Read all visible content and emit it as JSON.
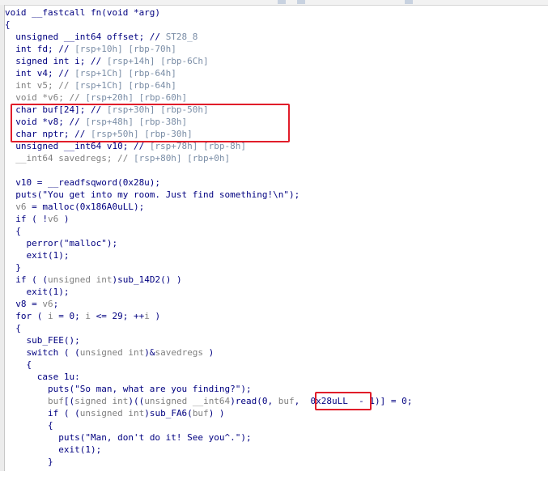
{
  "colors": {
    "normal": "#000080",
    "comment": "#7a8da6",
    "grey": "#808080",
    "highlight": "#e11d2a"
  },
  "code_lines": [
    [
      [
        "n",
        "void __fastcall fn(void *arg)"
      ]
    ],
    [
      [
        "n",
        "{"
      ]
    ],
    [
      [
        "n",
        "  unsigned __int64 offset; // "
      ],
      [
        "c",
        "ST28_8"
      ]
    ],
    [
      [
        "n",
        "  int fd; // "
      ],
      [
        "c",
        "[rsp+10h] [rbp-70h]"
      ]
    ],
    [
      [
        "n",
        "  signed int i; // "
      ],
      [
        "c",
        "[rsp+14h] [rbp-6Ch]"
      ]
    ],
    [
      [
        "n",
        "  int v4; // "
      ],
      [
        "c",
        "[rsp+1Ch] [rbp-64h]"
      ]
    ],
    [
      [
        "g",
        "  int v5; // "
      ],
      [
        "c",
        "[rsp+1Ch] [rbp-64h]"
      ]
    ],
    [
      [
        "g",
        "  void *v6; // "
      ],
      [
        "c",
        "[rsp+20h] [rbp-60h]"
      ]
    ],
    [
      [
        "n",
        "  char buf[24]; // "
      ],
      [
        "c",
        "[rsp+30h] [rbp-50h]"
      ]
    ],
    [
      [
        "n",
        "  void *v8; // "
      ],
      [
        "c",
        "[rsp+48h] [rbp-38h]"
      ]
    ],
    [
      [
        "n",
        "  char nptr; // "
      ],
      [
        "c",
        "[rsp+50h] [rbp-30h]"
      ]
    ],
    [
      [
        "n",
        "  unsigned __int64 v10; // "
      ],
      [
        "c",
        "[rsp+78h] [rbp-8h]"
      ]
    ],
    [
      [
        "g",
        "  __int64 savedregs; // "
      ],
      [
        "c",
        "[rsp+80h] [rbp+0h]"
      ]
    ],
    [
      [
        "n",
        ""
      ]
    ],
    [
      [
        "n",
        "  v10 = __readfsqword(0x28u);"
      ]
    ],
    [
      [
        "n",
        "  puts("
      ],
      [
        "s",
        "\"You get into my room. Just find something!\\n\""
      ],
      [
        "n",
        ");"
      ]
    ],
    [
      [
        "g",
        "  v6"
      ],
      [
        "n",
        " = malloc(0x186A0uLL);"
      ]
    ],
    [
      [
        "n",
        "  if ( !"
      ],
      [
        "g",
        "v6"
      ],
      [
        "n",
        " )"
      ]
    ],
    [
      [
        "n",
        "  {"
      ]
    ],
    [
      [
        "n",
        "    perror("
      ],
      [
        "s",
        "\"malloc\""
      ],
      [
        "n",
        ");"
      ]
    ],
    [
      [
        "n",
        "    exit(1);"
      ]
    ],
    [
      [
        "n",
        "  }"
      ]
    ],
    [
      [
        "n",
        "  if ( ("
      ],
      [
        "g",
        "unsigned int"
      ],
      [
        "n",
        ")sub_14D2() )"
      ]
    ],
    [
      [
        "n",
        "    exit(1);"
      ]
    ],
    [
      [
        "n",
        "  v8 = "
      ],
      [
        "g",
        "v6"
      ],
      [
        "n",
        ";"
      ]
    ],
    [
      [
        "n",
        "  for ( "
      ],
      [
        "g",
        "i"
      ],
      [
        "n",
        " = 0; "
      ],
      [
        "g",
        "i"
      ],
      [
        "n",
        " <= 29; ++"
      ],
      [
        "g",
        "i"
      ],
      [
        "n",
        " )"
      ]
    ],
    [
      [
        "n",
        "  {"
      ]
    ],
    [
      [
        "n",
        "    sub_FEE();"
      ]
    ],
    [
      [
        "n",
        "    switch ( ("
      ],
      [
        "g",
        "unsigned int"
      ],
      [
        "n",
        ")&"
      ],
      [
        "g",
        "savedregs"
      ],
      [
        "n",
        " )"
      ]
    ],
    [
      [
        "n",
        "    {"
      ]
    ],
    [
      [
        "n",
        "      case 1u:"
      ]
    ],
    [
      [
        "n",
        "        puts("
      ],
      [
        "s",
        "\"So man, what are you finding?\""
      ],
      [
        "n",
        ");"
      ]
    ],
    [
      [
        "g",
        "        buf"
      ],
      [
        "n",
        "[("
      ],
      [
        "g",
        "signed int"
      ],
      [
        "n",
        ")(("
      ],
      [
        "g",
        "unsigned __int64"
      ],
      [
        "n",
        ")read(0, "
      ],
      [
        "g",
        "buf"
      ],
      [
        "n",
        ",  0x28uLL  - 1)] = 0;"
      ]
    ],
    [
      [
        "n",
        "        if ( ("
      ],
      [
        "g",
        "unsigned int"
      ],
      [
        "n",
        ")sub_FA6("
      ],
      [
        "g",
        "buf"
      ],
      [
        "n",
        ") )"
      ]
    ],
    [
      [
        "n",
        "        {"
      ]
    ],
    [
      [
        "n",
        "          puts("
      ],
      [
        "s",
        "\"Man, don't do it! See you^.\""
      ],
      [
        "n",
        ");"
      ]
    ],
    [
      [
        "n",
        "          exit(1);"
      ]
    ],
    [
      [
        "n",
        "        }"
      ]
    ],
    [
      [
        "n",
        "        "
      ]
    ]
  ]
}
